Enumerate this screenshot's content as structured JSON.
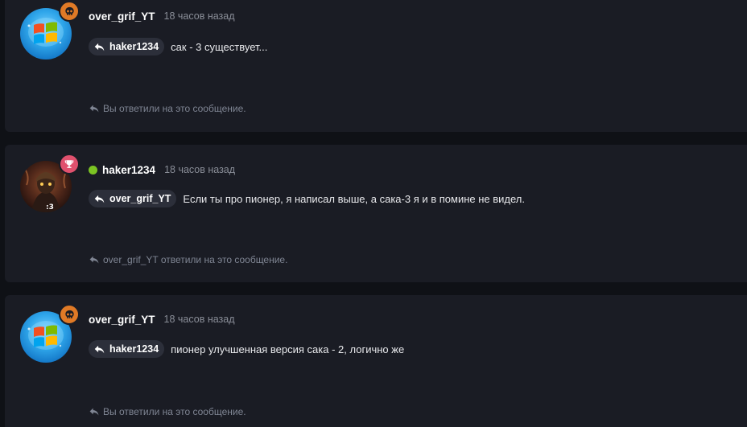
{
  "messages": [
    {
      "author": "over_grif_YT",
      "time": "18 часов назад",
      "avatar": "windows-logo",
      "badge": "skull",
      "badge_color": "#e07a26",
      "online": false,
      "reply_to": "haker1234",
      "text": "сак - 3 существует...",
      "footer": "Вы ответили на это сообщение."
    },
    {
      "author": "haker1234",
      "time": "18 часов назад",
      "avatar": "character-portrait",
      "badge": "trophy",
      "badge_color": "#e0516e",
      "online": true,
      "reply_to": "over_grif_YT",
      "text": "Если ты про пионер, я написал выше, а сака-3 я и в помине не видел.",
      "footer": "over_grif_YT ответили на это сообщение."
    },
    {
      "author": "over_grif_YT",
      "time": "18 часов назад",
      "avatar": "windows-logo",
      "badge": "skull",
      "badge_color": "#e07a26",
      "online": false,
      "reply_to": "haker1234",
      "text": "пионер улучшенная версия сака - 2, логично же",
      "footer": "Вы ответили на это сообщение."
    }
  ],
  "colors": {
    "background": "#0f1116",
    "card": "#1a1c24",
    "chip": "#2c2f3a",
    "online": "#7cc423",
    "muted": "#8a8e98"
  }
}
